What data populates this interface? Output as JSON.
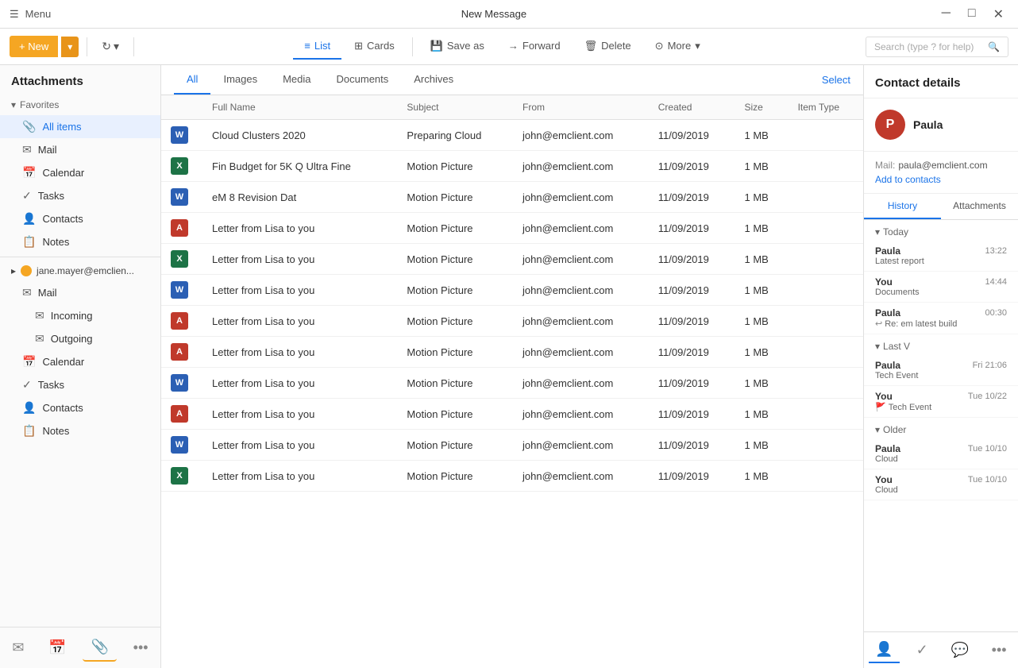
{
  "titlebar": {
    "menu_label": "Menu",
    "title": "New Message",
    "minimize": "─",
    "maximize": "□",
    "close": "✕"
  },
  "toolbar": {
    "new_label": "+ New",
    "refresh_icon": "↻",
    "tabs": [
      {
        "id": "list",
        "label": "List",
        "icon": "≡",
        "active": true
      },
      {
        "id": "cards",
        "label": "Cards",
        "icon": "⊞"
      },
      {
        "id": "save_as",
        "label": "Save as",
        "icon": "💾"
      },
      {
        "id": "forward",
        "label": "Forward",
        "icon": "→"
      },
      {
        "id": "delete",
        "label": "Delete",
        "icon": "🗑"
      },
      {
        "id": "more",
        "label": "More",
        "icon": "⊙"
      }
    ],
    "search_placeholder": "Search (type ? for help)"
  },
  "sidebar": {
    "header": "Attachments",
    "favorites_label": "Favorites",
    "items_favorites": [
      {
        "id": "all-items",
        "label": "All items",
        "icon": "📎",
        "active": true
      },
      {
        "id": "mail",
        "label": "Mail",
        "icon": "✉"
      },
      {
        "id": "calendar",
        "label": "Calendar",
        "icon": "📅"
      },
      {
        "id": "tasks",
        "label": "Tasks",
        "icon": "✓"
      },
      {
        "id": "contacts",
        "label": "Contacts",
        "icon": "👤"
      },
      {
        "id": "notes",
        "label": "Notes",
        "icon": "📋"
      }
    ],
    "account_label": "jane.mayer@emclien...",
    "items_account": [
      {
        "id": "mail2",
        "label": "Mail",
        "icon": "✉",
        "sub": false
      },
      {
        "id": "incoming",
        "label": "Incoming",
        "icon": "✉",
        "sub": true
      },
      {
        "id": "outgoing",
        "label": "Outgoing",
        "icon": "✉",
        "sub": true
      },
      {
        "id": "calendar2",
        "label": "Calendar",
        "icon": "📅",
        "sub": false
      },
      {
        "id": "tasks2",
        "label": "Tasks",
        "icon": "✓",
        "sub": false
      },
      {
        "id": "contacts2",
        "label": "Contacts",
        "icon": "👤",
        "sub": false
      },
      {
        "id": "notes2",
        "label": "Notes",
        "icon": "📋",
        "sub": false
      }
    ],
    "bottom_nav": [
      {
        "id": "mail-nav",
        "icon": "✉",
        "active": false
      },
      {
        "id": "calendar-nav",
        "icon": "📅",
        "active": false
      },
      {
        "id": "attachments-nav",
        "icon": "📎",
        "active": true
      },
      {
        "id": "more-nav",
        "icon": "•••",
        "active": false
      }
    ]
  },
  "content": {
    "tabs": [
      {
        "id": "all",
        "label": "All",
        "active": true
      },
      {
        "id": "images",
        "label": "Images"
      },
      {
        "id": "media",
        "label": "Media"
      },
      {
        "id": "documents",
        "label": "Documents"
      },
      {
        "id": "archives",
        "label": "Archives"
      }
    ],
    "select_label": "Select",
    "table_headers": [
      "",
      "Full Name",
      "Subject",
      "From",
      "Created",
      "Size",
      "Item Type"
    ],
    "rows": [
      {
        "type": "word",
        "name": "Cloud Clusters 2020",
        "subject": "Preparing Cloud",
        "from": "john@emclient.com",
        "created": "11/09/2019",
        "size": "1 MB",
        "item_type": ""
      },
      {
        "type": "excel",
        "name": "Fin Budget for 5K Q Ultra Fine",
        "subject": "Motion Picture",
        "from": "john@emclient.com",
        "created": "11/09/2019",
        "size": "1 MB",
        "item_type": ""
      },
      {
        "type": "word",
        "name": "eM 8 Revision Dat",
        "subject": "Motion Picture",
        "from": "john@emclient.com",
        "created": "11/09/2019",
        "size": "1 MB",
        "item_type": ""
      },
      {
        "type": "pdf",
        "name": "Letter from Lisa to you",
        "subject": "Motion Picture",
        "from": "john@emclient.com",
        "created": "11/09/2019",
        "size": "1 MB",
        "item_type": ""
      },
      {
        "type": "excel",
        "name": "Letter from Lisa to you",
        "subject": "Motion Picture",
        "from": "john@emclient.com",
        "created": "11/09/2019",
        "size": "1 MB",
        "item_type": ""
      },
      {
        "type": "word",
        "name": "Letter from Lisa to you",
        "subject": "Motion Picture",
        "from": "john@emclient.com",
        "created": "11/09/2019",
        "size": "1 MB",
        "item_type": ""
      },
      {
        "type": "pdf",
        "name": "Letter from Lisa to you",
        "subject": "Motion Picture",
        "from": "john@emclient.com",
        "created": "11/09/2019",
        "size": "1 MB",
        "item_type": ""
      },
      {
        "type": "pdf",
        "name": "Letter from Lisa to you",
        "subject": "Motion Picture",
        "from": "john@emclient.com",
        "created": "11/09/2019",
        "size": "1 MB",
        "item_type": ""
      },
      {
        "type": "word",
        "name": "Letter from Lisa to you",
        "subject": "Motion Picture",
        "from": "john@emclient.com",
        "created": "11/09/2019",
        "size": "1 MB",
        "item_type": ""
      },
      {
        "type": "pdf",
        "name": "Letter from Lisa to you",
        "subject": "Motion Picture",
        "from": "john@emclient.com",
        "created": "11/09/2019",
        "size": "1 MB",
        "item_type": ""
      },
      {
        "type": "word",
        "name": "Letter from Lisa to you",
        "subject": "Motion Picture",
        "from": "john@emclient.com",
        "created": "11/09/2019",
        "size": "1 MB",
        "item_type": ""
      },
      {
        "type": "excel",
        "name": "Letter from Lisa to you",
        "subject": "Motion Picture",
        "from": "john@emclient.com",
        "created": "11/09/2019",
        "size": "1 MB",
        "item_type": ""
      }
    ]
  },
  "contact_panel": {
    "header": "Contact details",
    "avatar_letter": "P",
    "name": "Paula",
    "mail_label": "Mail:",
    "email": "paula@emclient.com",
    "add_to_contacts": "Add to contacts",
    "tabs": [
      {
        "id": "history",
        "label": "History",
        "active": true
      },
      {
        "id": "attachments",
        "label": "Attachments"
      }
    ],
    "history_groups": [
      {
        "id": "today",
        "label": "Today",
        "items": [
          {
            "sender": "Paula",
            "time": "13:22",
            "subject": "Latest report",
            "icon": ""
          },
          {
            "sender": "You",
            "time": "14:44",
            "subject": "Documents",
            "icon": ""
          },
          {
            "sender": "Paula",
            "time": "00:30",
            "subject": "Re: em latest build",
            "icon": "↩"
          }
        ]
      },
      {
        "id": "last-week",
        "label": "Last V",
        "items": [
          {
            "sender": "Paula",
            "time": "Fri 21:06",
            "subject": "Tech Event",
            "icon": ""
          },
          {
            "sender": "You",
            "time": "Tue 10/22",
            "subject": "Tech Event",
            "icon": "🚩"
          }
        ]
      },
      {
        "id": "older",
        "label": "Older",
        "items": [
          {
            "sender": "Paula",
            "time": "Tue 10/10",
            "subject": "Cloud",
            "icon": ""
          },
          {
            "sender": "You",
            "time": "Tue 10/10",
            "subject": "Cloud",
            "icon": ""
          }
        ]
      }
    ],
    "bottom_nav": [
      {
        "id": "contact-icon",
        "icon": "👤",
        "active": true
      },
      {
        "id": "check-icon",
        "icon": "✓",
        "active": false
      },
      {
        "id": "chat-icon",
        "icon": "💬",
        "active": false
      },
      {
        "id": "more-icon",
        "icon": "•••",
        "active": false
      }
    ]
  }
}
